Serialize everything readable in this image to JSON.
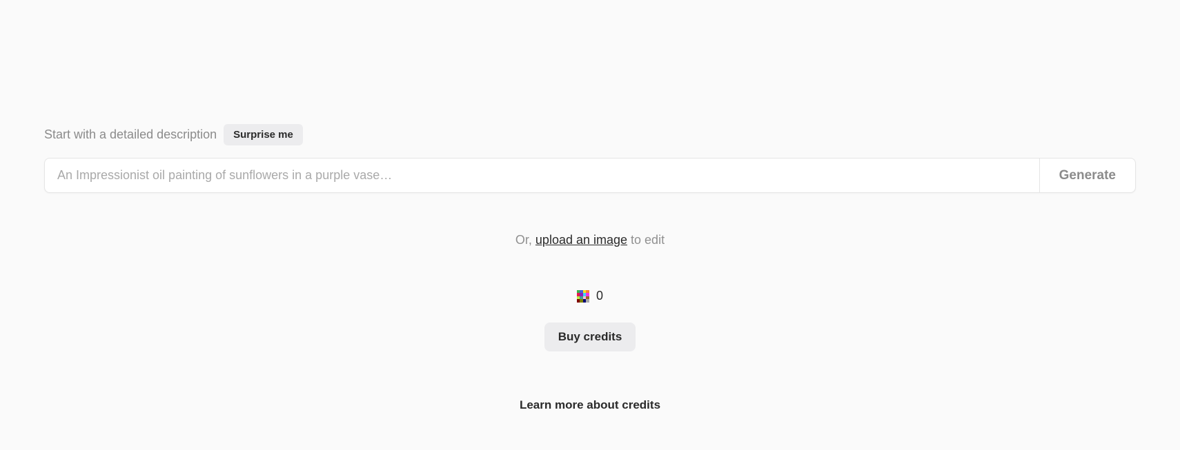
{
  "header": {
    "description_label": "Start with a detailed description",
    "surprise_label": "Surprise me"
  },
  "prompt": {
    "placeholder": "An Impressionist oil painting of sunflowers in a purple vase…",
    "value": "",
    "generate_label": "Generate"
  },
  "upload": {
    "prefix": "Or, ",
    "link_text": "upload an image",
    "suffix": " to edit"
  },
  "credits": {
    "count": "0",
    "buy_label": "Buy credits",
    "learn_more_label": "Learn more about credits"
  }
}
